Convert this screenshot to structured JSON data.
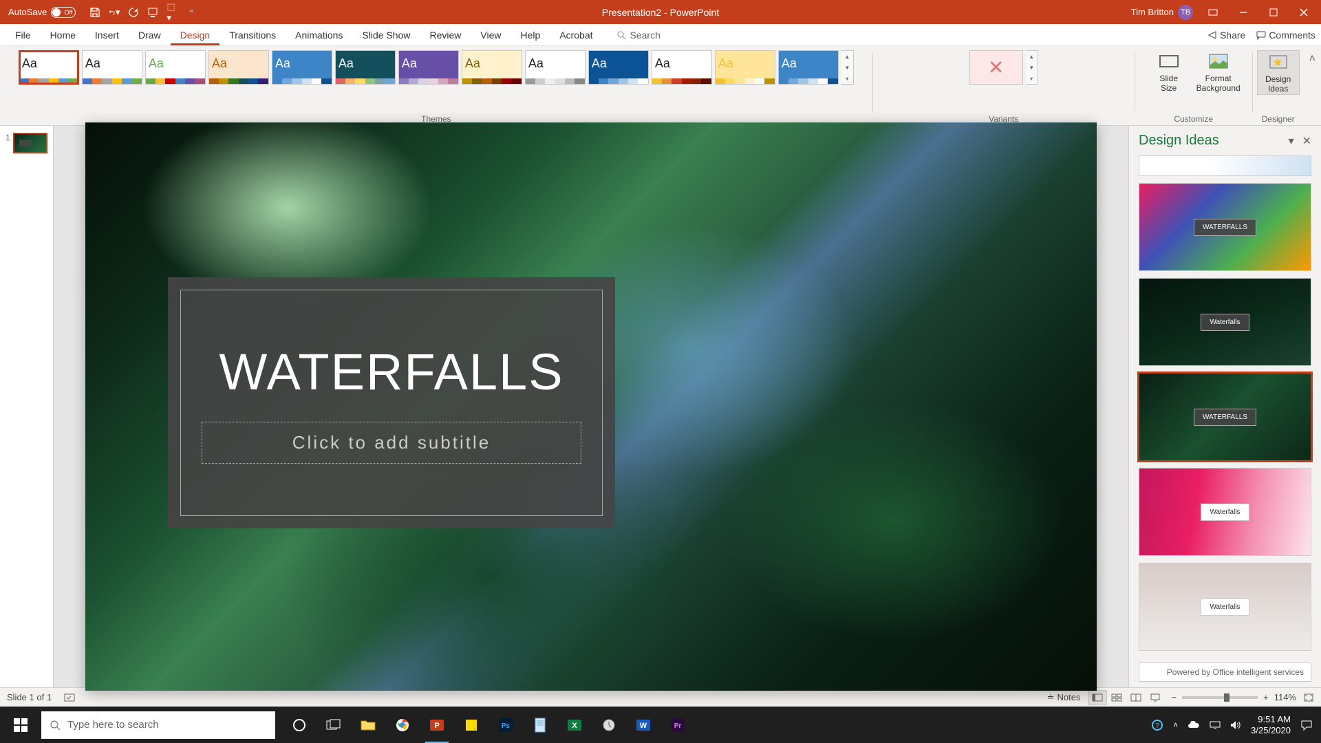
{
  "titlebar": {
    "autosave_label": "AutoSave",
    "autosave_state": "Off",
    "doc_title": "Presentation2 - PowerPoint",
    "user_name": "Tim Britton",
    "user_initials": "TB"
  },
  "tabs": {
    "file": "File",
    "home": "Home",
    "insert": "Insert",
    "draw": "Draw",
    "design": "Design",
    "transitions": "Transitions",
    "animations": "Animations",
    "slideshow": "Slide Show",
    "review": "Review",
    "view": "View",
    "help": "Help",
    "acrobat": "Acrobat",
    "search": "Search"
  },
  "share": {
    "share": "Share",
    "comments": "Comments"
  },
  "ribbon": {
    "themes_label": "Themes",
    "variants_label": "Variants",
    "customize_label": "Customize",
    "designer_label": "Designer",
    "slide_size": "Slide\nSize",
    "format_bg": "Format\nBackground",
    "design_ideas": "Design\nIdeas",
    "themes": [
      {
        "aa_color": "#222",
        "bg": "#fff",
        "bar": [
          "#4472c4",
          "#ed7d31",
          "#a5a5a5",
          "#ffc000",
          "#5b9bd5",
          "#70ad47"
        ]
      },
      {
        "aa_color": "#222",
        "bg": "#fff",
        "bar": [
          "#4472c4",
          "#ed7d31",
          "#a5a5a5",
          "#ffc000",
          "#5b9bd5",
          "#70ad47"
        ]
      },
      {
        "aa_color": "#6aa84f",
        "bg": "#fff",
        "bar": [
          "#6aa84f",
          "#f1c232",
          "#cc0000",
          "#3d85c6",
          "#674ea7",
          "#a64d79"
        ]
      },
      {
        "aa_color": "#b45f06",
        "bg": "#fce5cd",
        "bar": [
          "#b45f06",
          "#bf9000",
          "#38761d",
          "#134f5c",
          "#0b5394",
          "#351c75"
        ]
      },
      {
        "aa_color": "#fff",
        "bg": "#3d85c6",
        "bar": [
          "#3d85c6",
          "#6fa8dc",
          "#9fc5e8",
          "#cfe2f3",
          "#fff",
          "#0b5394"
        ]
      },
      {
        "aa_color": "#fff",
        "bg": "#134f5c",
        "bar": [
          "#e06666",
          "#f6b26b",
          "#ffd966",
          "#93c47d",
          "#76a5af",
          "#6fa8dc"
        ]
      },
      {
        "aa_color": "#fff",
        "bg": "#674ea7",
        "bar": [
          "#8e7cc3",
          "#b4a7d6",
          "#d9d2e9",
          "#ead1dc",
          "#d5a6bd",
          "#c27ba0"
        ]
      },
      {
        "aa_color": "#7f6000",
        "bg": "#fff2cc",
        "bar": [
          "#bf9000",
          "#7f6000",
          "#b45f06",
          "#783f04",
          "#990000",
          "#660000"
        ]
      },
      {
        "aa_color": "#222",
        "bg": "#fff",
        "bar": [
          "#999",
          "#ccc",
          "#eee",
          "#ddd",
          "#bbb",
          "#888"
        ]
      },
      {
        "aa_color": "#fff",
        "bg": "#0b5394",
        "bar": [
          "#0b5394",
          "#3d85c6",
          "#6fa8dc",
          "#9fc5e8",
          "#cfe2f3",
          "#fff"
        ]
      },
      {
        "aa_color": "#222",
        "bg": "#fff",
        "bar": [
          "#f1c232",
          "#e69138",
          "#cc4125",
          "#a61c00",
          "#85200c",
          "#5b0f00"
        ]
      },
      {
        "aa_color": "#f1c232",
        "bg": "#ffe599",
        "bar": [
          "#f1c232",
          "#ffd966",
          "#ffe599",
          "#fff2cc",
          "#fff",
          "#bf9000"
        ]
      },
      {
        "aa_color": "#fff",
        "bg": "#3d85c6",
        "bar": [
          "#3d85c6",
          "#6fa8dc",
          "#9fc5e8",
          "#cfe2f3",
          "#fff",
          "#0b5394"
        ]
      }
    ]
  },
  "design_pane": {
    "title": "Design Ideas",
    "footer": "Powered by Office intelligent services",
    "ideas": [
      {
        "label": "",
        "style": "short",
        "bg": "linear-gradient(90deg,#fff 40%,#cfe2f3)"
      },
      {
        "label": "WATERFALLS",
        "style": "",
        "bg": "linear-gradient(135deg,#e91e63,#3f51b5,#4caf50,#ff9800)"
      },
      {
        "label": "Waterfalls",
        "style": "",
        "bg": "linear-gradient(160deg,#051510,#0a2818,#1a4030)"
      },
      {
        "label": "WATERFALLS",
        "style": "selected",
        "bg": "linear-gradient(135deg,#0a1f12,#1a5030,#0d2818)"
      },
      {
        "label": "Waterfalls",
        "style": "",
        "bg": "linear-gradient(100deg,#c2185b,#e91e63,#f48fb1,#fce4ec)"
      },
      {
        "label": "Waterfalls",
        "style": "",
        "bg": "linear-gradient(180deg,#d7ccc8,#efebe9)"
      }
    ]
  },
  "slide": {
    "title": "WATERFALLS",
    "subtitle_placeholder": "Click to add subtitle"
  },
  "thumbs": {
    "slide1_num": "1"
  },
  "statusbar": {
    "slide_count": "Slide 1 of 1",
    "notes": "Notes",
    "zoom": "114%"
  },
  "taskbar": {
    "search_placeholder": "Type here to search",
    "time": "9:51 AM",
    "date": "3/25/2020"
  }
}
